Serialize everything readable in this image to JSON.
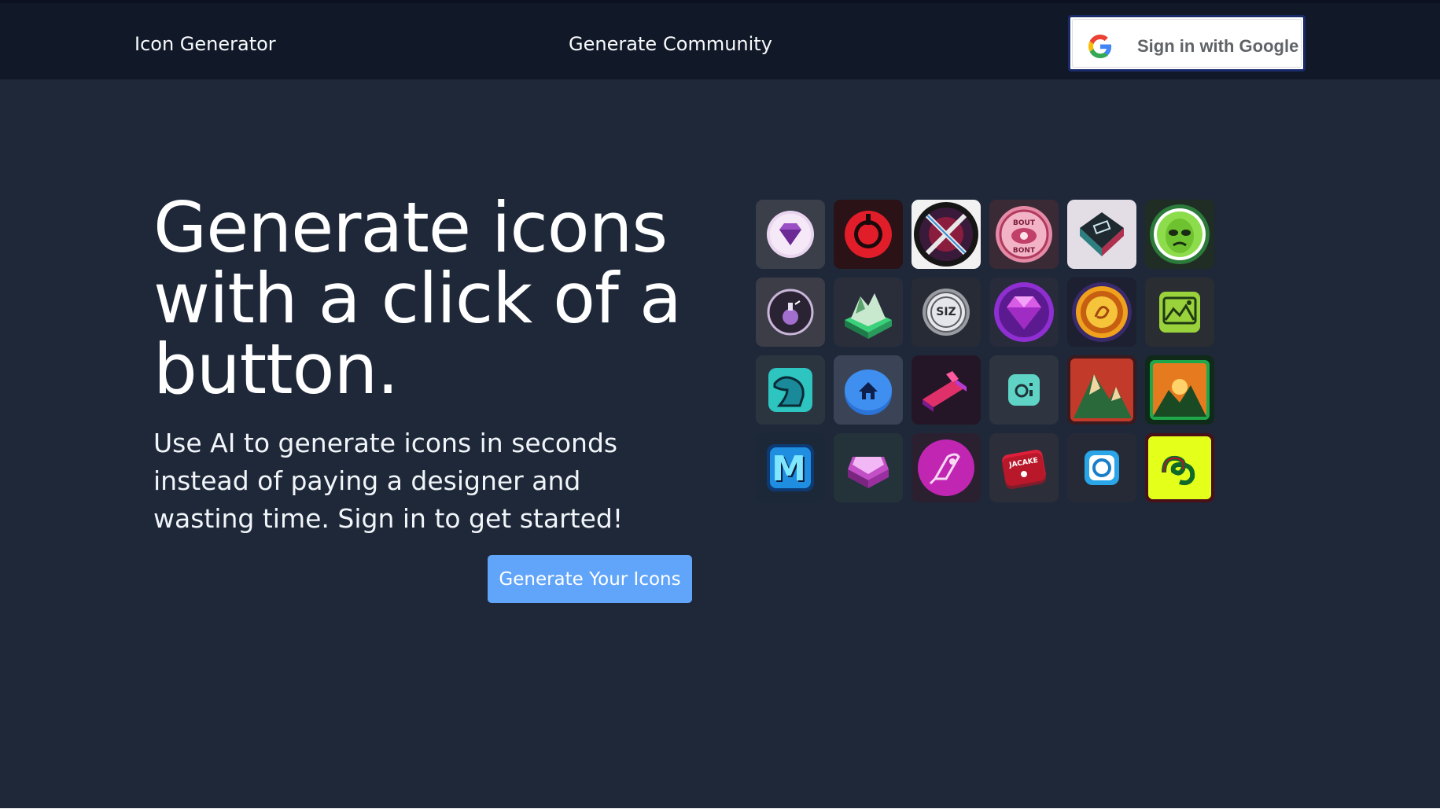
{
  "header": {
    "brand": "Icon Generator",
    "nav": [
      {
        "label": "Generate"
      },
      {
        "label": "Community"
      }
    ],
    "signin_label": "Sign in with Google"
  },
  "hero": {
    "title": "Generate icons with a click of a button.",
    "subtitle": "Use AI to generate icons in seconds instead of paying a designer and wasting time. Sign in to get started!",
    "cta_label": "Generate Your Icons"
  },
  "colors": {
    "header_bg": "#111827",
    "page_bg": "#1e2839",
    "cta_bg": "#60a5fa"
  },
  "icon_grid": [
    {
      "name": "purple-gem-icon",
      "text": ""
    },
    {
      "name": "red-power-ring-icon",
      "text": ""
    },
    {
      "name": "crossed-swords-icon",
      "text": ""
    },
    {
      "name": "pink-badge-icon",
      "text": "BOUT BONT"
    },
    {
      "name": "dark-cube-icon",
      "text": ""
    },
    {
      "name": "green-alien-icon",
      "text": ""
    },
    {
      "name": "potion-orb-icon",
      "text": ""
    },
    {
      "name": "green-mountain-block-icon",
      "text": ""
    },
    {
      "name": "silver-coin-icon",
      "text": "SIZ"
    },
    {
      "name": "purple-diamond-icon",
      "text": ""
    },
    {
      "name": "gold-coin-icon",
      "text": ""
    },
    {
      "name": "green-landscape-icon",
      "text": ""
    },
    {
      "name": "teal-arm-icon",
      "text": ""
    },
    {
      "name": "blue-home-icon",
      "text": ""
    },
    {
      "name": "pink-pencil-icon",
      "text": ""
    },
    {
      "name": "teal-camera-icon",
      "text": ""
    },
    {
      "name": "red-mountain-icon",
      "text": ""
    },
    {
      "name": "sunset-mountain-icon",
      "text": ""
    },
    {
      "name": "blue-letter-m-icon",
      "text": "M"
    },
    {
      "name": "pink-hexagon-icon",
      "text": ""
    },
    {
      "name": "magenta-rocket-icon",
      "text": ""
    },
    {
      "name": "red-ticket-icon",
      "text": "JACAKE"
    },
    {
      "name": "blue-camera-icon",
      "text": ""
    },
    {
      "name": "yellow-swirl-icon",
      "text": ""
    }
  ]
}
